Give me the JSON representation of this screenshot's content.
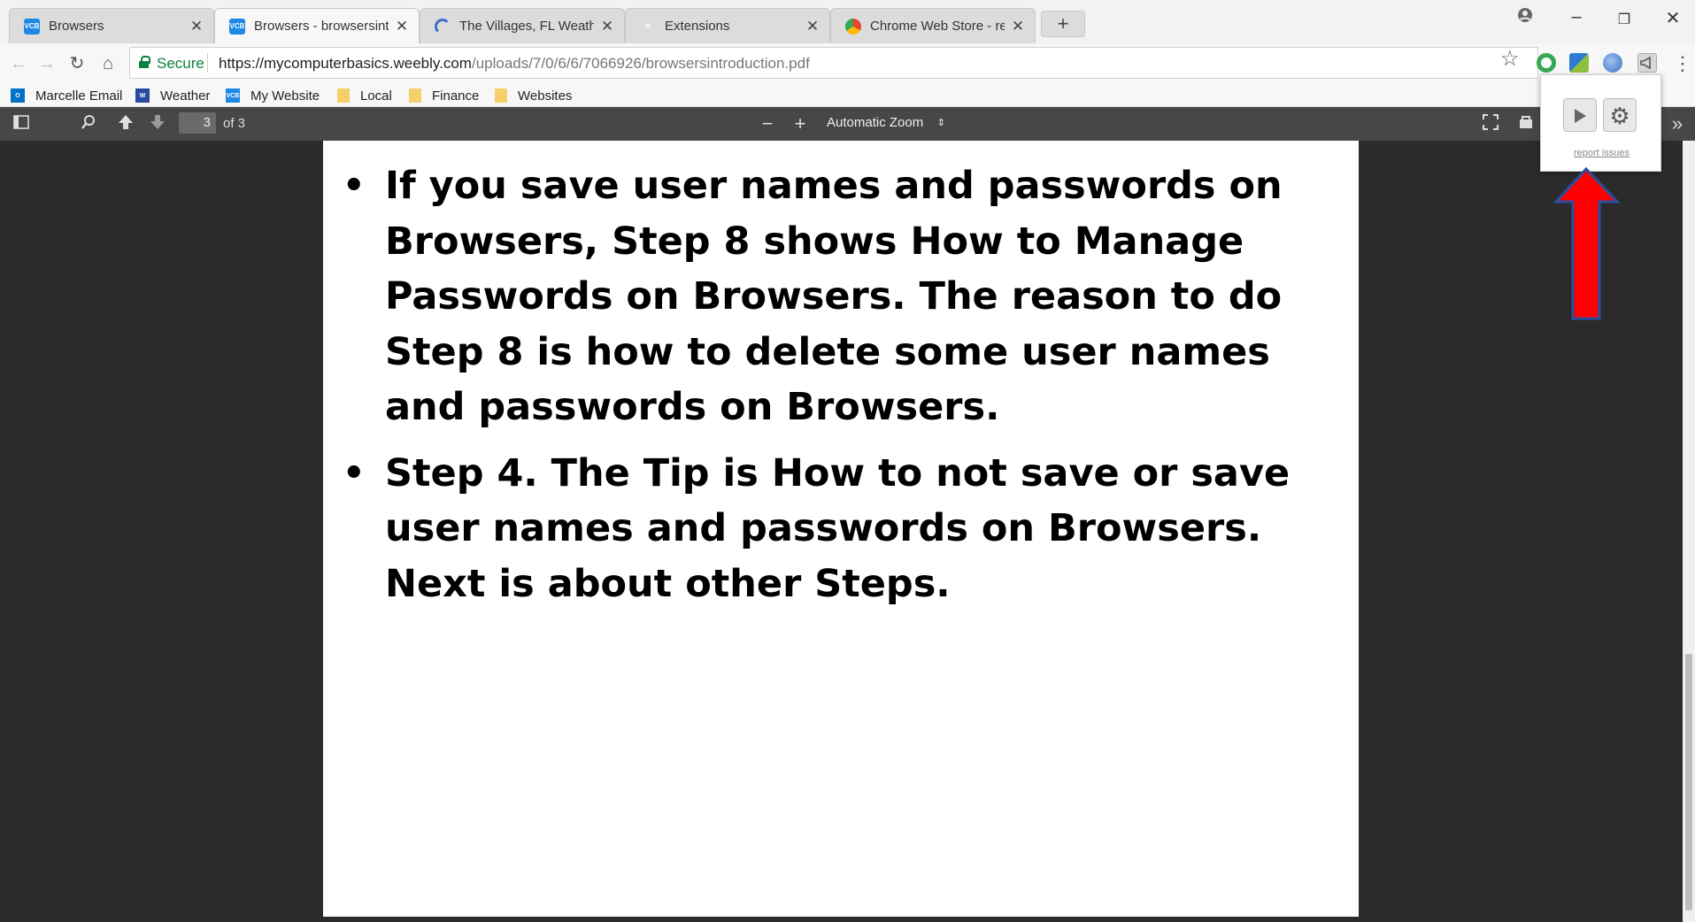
{
  "tabs": [
    {
      "title": "Browsers",
      "favicon": "vcb-icon"
    },
    {
      "title": "Browsers - browsersintro",
      "favicon": "vcb-icon",
      "active": true
    },
    {
      "title": "The Villages, FL Weather",
      "favicon": "loading-spinner-icon"
    },
    {
      "title": "Extensions",
      "favicon": "puzzle-icon"
    },
    {
      "title": "Chrome Web Store - rea",
      "favicon": "chrome-webstore-icon"
    }
  ],
  "new_tab_label": "+",
  "address_bar": {
    "secure_label": "Secure",
    "url_host": "https://mycomputerbasics.weebly.com",
    "url_path": "/uploads/7/0/6/6/7066926/browsersintroduction.pdf"
  },
  "bookmarks": [
    {
      "label": "Marcelle Email",
      "icon": "outlook-icon"
    },
    {
      "label": "Weather",
      "icon": "weather-icon"
    },
    {
      "label": "My Website",
      "icon": "vcb-icon"
    },
    {
      "label": "Local",
      "icon": "folder-icon"
    },
    {
      "label": "Finance",
      "icon": "folder-icon"
    },
    {
      "label": "Websites",
      "icon": "folder-icon"
    }
  ],
  "pdf_toolbar": {
    "page_number": "3",
    "page_count": "of 3",
    "zoom_label": "Automatic Zoom"
  },
  "document": {
    "bullets": [
      "If you save user names and passwords on Browsers, Step 8 shows How to Manage Passwords on Browsers.  The reason to do Step 8 is how to delete some user names and passwords on Browsers.",
      "Step 4.  The Tip is How to not save or save user names and passwords on Browsers.  Next is about other Steps."
    ]
  },
  "extension_popup": {
    "report_link": "report issues"
  },
  "colors": {
    "annotation_arrow": "#ff0000",
    "annotation_arrow_outline": "#2b4fa0",
    "secure_green": "#0b8043"
  }
}
